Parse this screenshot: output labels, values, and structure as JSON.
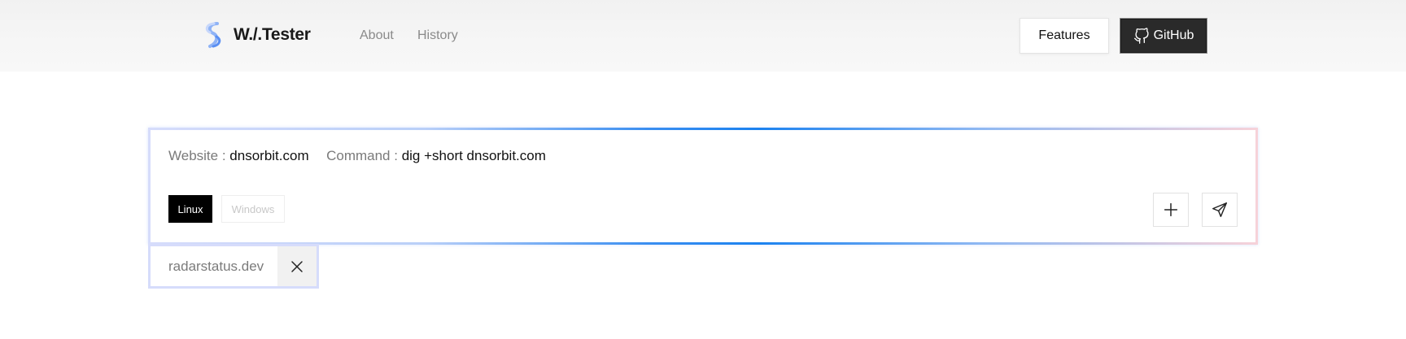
{
  "header": {
    "brand": "W./.Tester",
    "nav": [
      {
        "label": "About"
      },
      {
        "label": "History"
      }
    ],
    "features_label": "Features",
    "github_label": "GitHub"
  },
  "command_panel": {
    "website_label": "Website :",
    "website_value": "dnsorbit.com",
    "command_label": "Command :",
    "command_value": "dig +short dnsorbit.com",
    "os_options": [
      {
        "label": "Linux",
        "selected": true
      },
      {
        "label": "Windows",
        "selected": false
      }
    ],
    "add_icon": "plus-icon",
    "send_icon": "send-icon"
  },
  "chips": [
    {
      "label": "radarstatus.dev",
      "close_icon": "close-icon"
    }
  ],
  "colors": {
    "accent": "#1b82ef",
    "selected_os_bg": "#000000",
    "github_bg": "#2a2a2a"
  }
}
